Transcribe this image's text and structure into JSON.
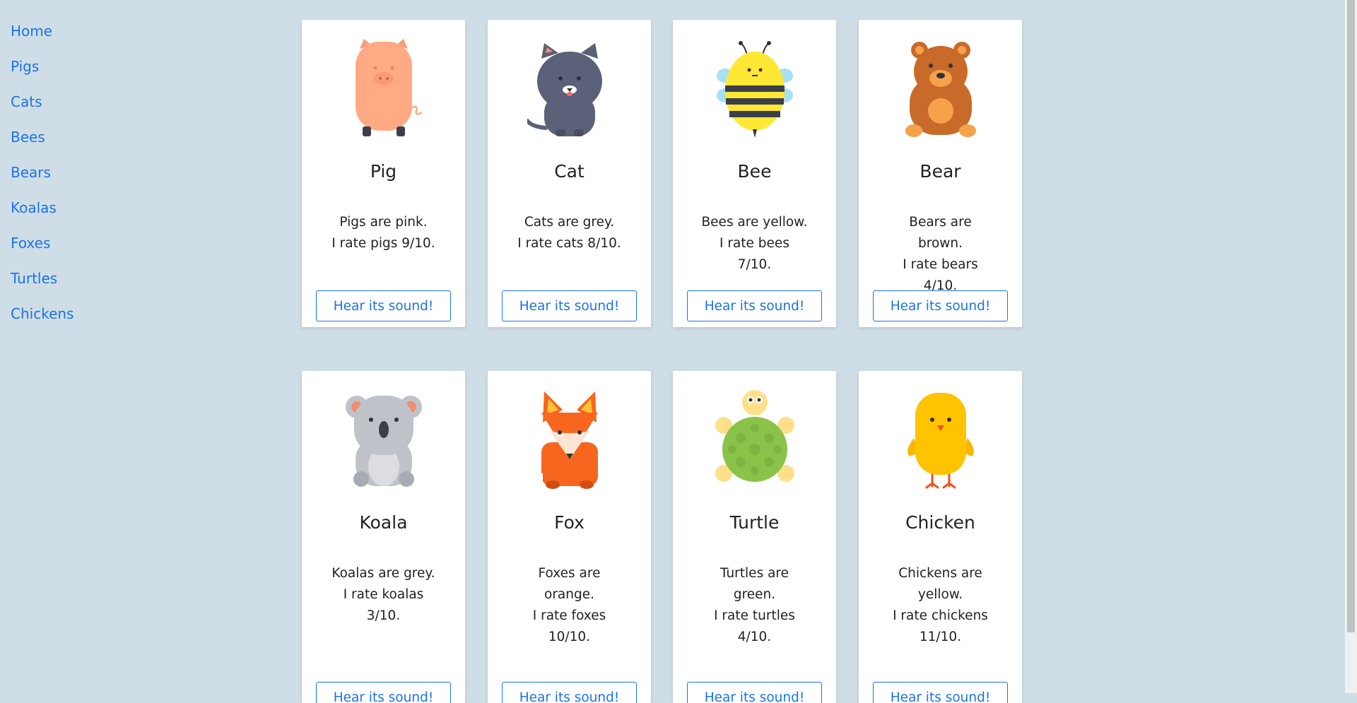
{
  "nav": {
    "items": [
      "Home",
      "Pigs",
      "Cats",
      "Bees",
      "Bears",
      "Koalas",
      "Foxes",
      "Turtles",
      "Chickens"
    ]
  },
  "cards": [
    {
      "name": "Pig",
      "line1": "Pigs are pink.",
      "line2": "I rate pigs 9/10.",
      "button": "Hear its sound!",
      "icon": "pig-icon"
    },
    {
      "name": "Cat",
      "line1": "Cats are grey.",
      "line2": "I rate cats 8/10.",
      "button": "Hear its sound!",
      "icon": "cat-icon"
    },
    {
      "name": "Bee",
      "line1": "Bees are yellow.",
      "line2": "I rate bees 7/10.",
      "button": "Hear its sound!",
      "icon": "bee-icon"
    },
    {
      "name": "Bear",
      "line1": "Bears are brown.",
      "line2": "I rate bears 4/10.",
      "button": "Hear its sound!",
      "icon": "bear-icon"
    },
    {
      "name": "Koala",
      "line1": "Koalas are grey.",
      "line2": "I rate koalas 3/10.",
      "button": "Hear its sound!",
      "icon": "koala-icon"
    },
    {
      "name": "Fox",
      "line1": "Foxes are orange.",
      "line2": "I rate foxes 10/10.",
      "button": "Hear its sound!",
      "icon": "fox-icon"
    },
    {
      "name": "Turtle",
      "line1": "Turtles are green.",
      "line2": "I rate turtles 4/10.",
      "button": "Hear its sound!",
      "icon": "turtle-icon"
    },
    {
      "name": "Chicken",
      "line1": "Chickens are yellow.",
      "line2": "I rate chickens 11/10.",
      "button": "Hear its sound!",
      "icon": "chicken-icon"
    }
  ],
  "colors": {
    "background": "#cfdee6",
    "link": "#1a73e8",
    "card": "#ffffff"
  }
}
